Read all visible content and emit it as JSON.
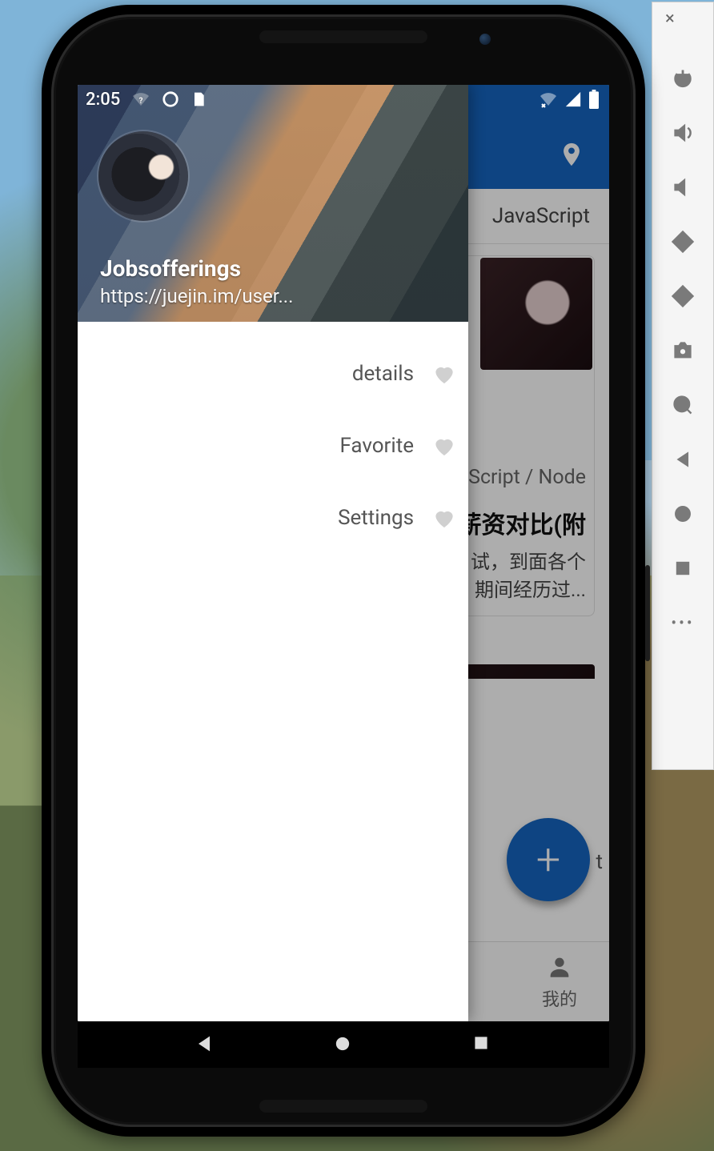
{
  "status": {
    "time": "2:05"
  },
  "drawer": {
    "username": "Jobsofferings",
    "profile_link": "https://juejin.im/user...",
    "items": [
      {
        "label": "details"
      },
      {
        "label": "Favorite"
      },
      {
        "label": "Settings"
      }
    ]
  },
  "tabs": {
    "visible": "JavaScript"
  },
  "cards": [
    {
      "meta_visible": "aScript / Node",
      "title_visible": "薪资对比(附",
      "desc_line1": "试，到面各个",
      "desc_line2": "期间经历过..."
    }
  ],
  "fab": {
    "glyph": "+"
  },
  "fab_side_text": "t",
  "bottom_nav": {
    "visible_item": {
      "label": "我的"
    }
  }
}
